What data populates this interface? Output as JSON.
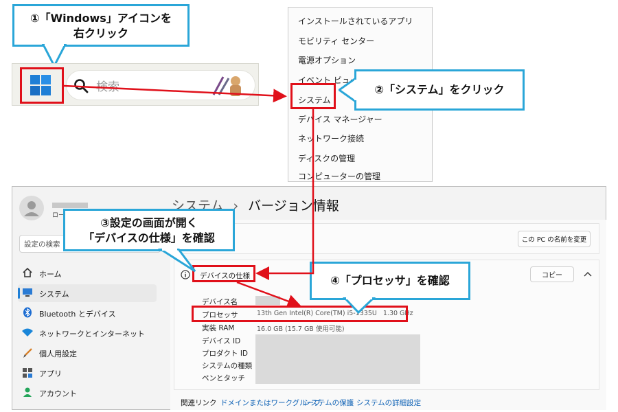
{
  "callouts": {
    "step1_line1": "①「Windows」アイコンを",
    "step1_line2": "右クリック",
    "step2": "②「システム」をクリック",
    "step3_line1": "③設定の画面が開く",
    "step3_line2": "「デバイスの仕様」を確認",
    "step4": "④「プロセッサ」を確認"
  },
  "taskbar": {
    "search_placeholder": "検索"
  },
  "context_menu": {
    "items": [
      "インストールされているアプリ",
      "モビリティ センター",
      "電源オプション",
      "イベント ビューアー",
      "システム",
      "デバイス マネージャー",
      "ネットワーク接続",
      "ディスクの管理",
      "コンピューターの管理"
    ]
  },
  "settings": {
    "breadcrumb_parent": "システム",
    "breadcrumb_sep": "›",
    "breadcrumb_current": "バージョン情報",
    "user_subtext": "ロー",
    "search_placeholder": "設定の検索",
    "rename_button": "この PC の名前を変更",
    "nav": [
      {
        "label": "ホーム",
        "icon": "home-icon"
      },
      {
        "label": "システム",
        "icon": "monitor-icon"
      },
      {
        "label": "Bluetooth とデバイス",
        "icon": "bluetooth-icon"
      },
      {
        "label": "ネットワークとインターネット",
        "icon": "wifi-icon"
      },
      {
        "label": "個人用設定",
        "icon": "brush-icon"
      },
      {
        "label": "アプリ",
        "icon": "apps-icon"
      },
      {
        "label": "アカウント",
        "icon": "account-icon"
      }
    ],
    "device_specs": {
      "heading": "デバイスの仕様",
      "copy_button": "コピー",
      "rows": [
        {
          "label": "デバイス名",
          "value": ""
        },
        {
          "label": "プロセッサ",
          "value": "13th Gen Intel(R) Core(TM) i5-1335U   1.30 GHz"
        },
        {
          "label": "実装 RAM",
          "value": "16.0 GB (15.7 GB 使用可能)"
        },
        {
          "label": "デバイス ID",
          "value": ""
        },
        {
          "label": "プロダクト ID",
          "value": ""
        },
        {
          "label": "システムの種類",
          "value": ""
        },
        {
          "label": "ペンとタッチ",
          "value": ""
        }
      ]
    },
    "related_links": {
      "label": "関連リンク",
      "links": [
        "ドメインまたはワークグループ",
        "システムの保護",
        "システムの詳細設定"
      ]
    }
  },
  "colors": {
    "callout_border": "#2aa6d8",
    "highlight_red": "#e0101a",
    "windows_blue": "#1f7fd6",
    "link_blue": "#0a5fb4"
  }
}
